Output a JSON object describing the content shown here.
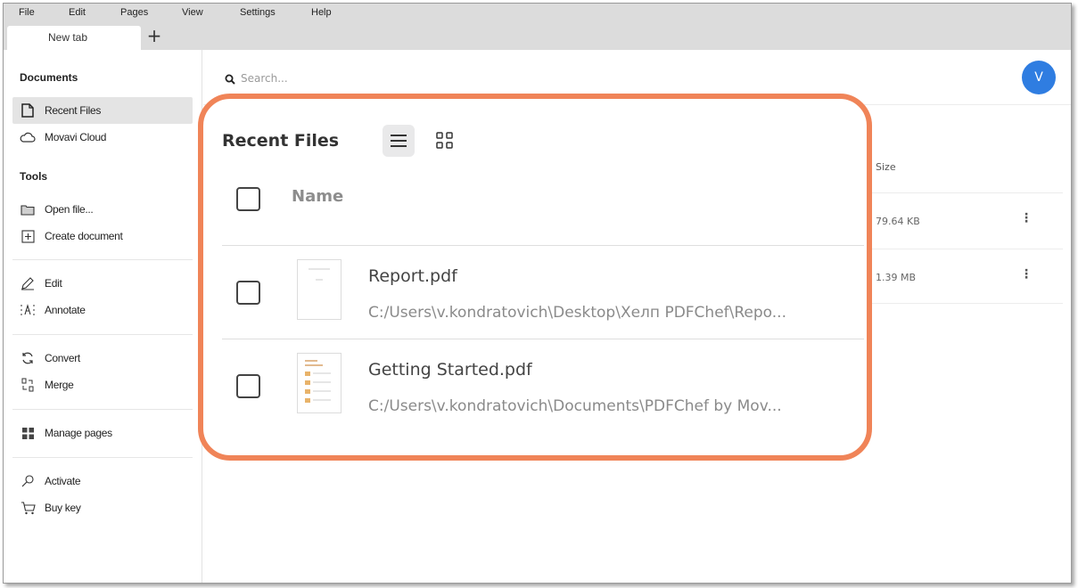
{
  "menu": [
    "File",
    "Edit",
    "Pages",
    "View",
    "Settings",
    "Help"
  ],
  "tab": {
    "label": "New tab",
    "add": "+"
  },
  "sidebar": {
    "documents_title": "Documents",
    "tools_title": "Tools",
    "items": [
      {
        "label": "Recent Files",
        "icon": "file-icon"
      },
      {
        "label": "Movavi Cloud",
        "icon": "cloud-icon"
      },
      {
        "label": "Open file...",
        "icon": "folder-icon"
      },
      {
        "label": "Create document",
        "icon": "plus-box-icon"
      },
      {
        "label": "Edit",
        "icon": "pencil-icon"
      },
      {
        "label": "Annotate",
        "icon": "annotate-icon"
      },
      {
        "label": "Convert",
        "icon": "convert-icon"
      },
      {
        "label": "Merge",
        "icon": "merge-icon"
      },
      {
        "label": "Manage pages",
        "icon": "grid-icon"
      },
      {
        "label": "Activate",
        "icon": "key-icon"
      },
      {
        "label": "Buy key",
        "icon": "cart-icon"
      }
    ]
  },
  "search": {
    "placeholder": "Search..."
  },
  "user": {
    "avatar_letter": "V",
    "avatar_color": "#2f7de1"
  },
  "recent": {
    "title": "Recent Files",
    "col_name": "Name",
    "col_size": "Size",
    "files": [
      {
        "name": "Report.pdf",
        "path": "C:/Users\\v.kondratovich\\Desktop\\Хелп PDFChef\\Repo...",
        "size": "79.64 KB"
      },
      {
        "name": "Getting Started.pdf",
        "path": "C:/Users\\v.kondratovich\\Documents\\PDFChef by Mov...",
        "size": "1.39 MB"
      }
    ]
  },
  "colors": {
    "highlight": "#f08458",
    "active_item": "#e4e4e4"
  }
}
